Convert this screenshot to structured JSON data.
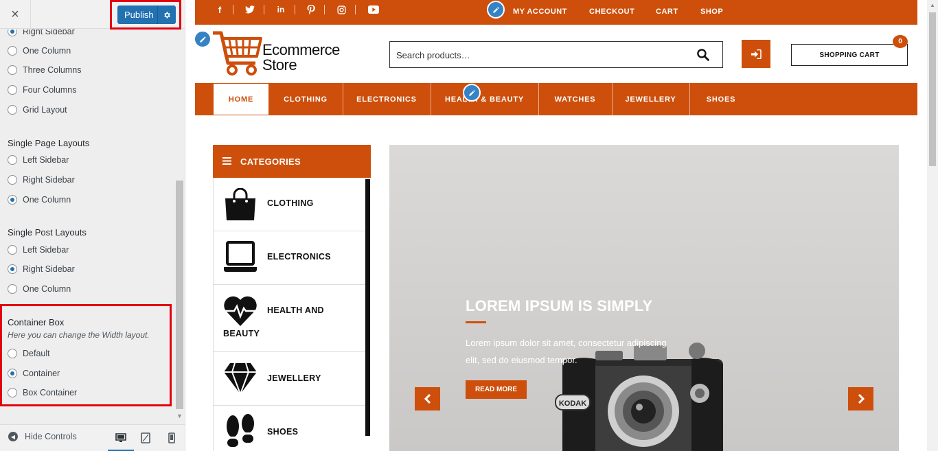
{
  "customizer": {
    "close_symbol": "×",
    "publish_label": "Publish",
    "archive_options": [
      {
        "label": "Right Sidebar",
        "checked": true
      },
      {
        "label": "One Column",
        "checked": false
      },
      {
        "label": "Three Columns",
        "checked": false
      },
      {
        "label": "Four Columns",
        "checked": false
      },
      {
        "label": "Grid Layout",
        "checked": false
      }
    ],
    "single_page": {
      "title": "Single Page Layouts",
      "options": [
        {
          "label": "Left Sidebar",
          "checked": false
        },
        {
          "label": "Right Sidebar",
          "checked": false
        },
        {
          "label": "One Column",
          "checked": true
        }
      ]
    },
    "single_post": {
      "title": "Single Post Layouts",
      "options": [
        {
          "label": "Left Sidebar",
          "checked": false
        },
        {
          "label": "Right Sidebar",
          "checked": true
        },
        {
          "label": "One Column",
          "checked": false
        }
      ]
    },
    "container_box": {
      "title": "Container Box",
      "description": "Here you can change the Width layout.",
      "options": [
        {
          "label": "Default",
          "checked": false
        },
        {
          "label": "Container",
          "checked": true
        },
        {
          "label": "Box Container",
          "checked": false
        }
      ]
    },
    "footer": {
      "hide_controls_label": "Hide Controls",
      "active_device": "desktop"
    }
  },
  "preview": {
    "topbar": {
      "social_icons": [
        "facebook-icon",
        "twitter-icon",
        "linkedin-icon",
        "pinterest-icon",
        "instagram-icon",
        "youtube-icon"
      ],
      "links": [
        "MY ACCOUNT",
        "CHECKOUT",
        "CART",
        "SHOP"
      ]
    },
    "logo": {
      "line1": "Ecommerce",
      "line2": "Store"
    },
    "search": {
      "placeholder": "Search products…"
    },
    "cart": {
      "label": "SHOPPING CART",
      "count": "0"
    },
    "nav": {
      "items": [
        "HOME",
        "CLOTHING",
        "ELECTRONICS",
        "HEALTH & BEAUTY",
        "WATCHES",
        "JEWELLERY",
        "SHOES"
      ],
      "active": "HOME"
    },
    "categories": {
      "title": "CATEGORIES",
      "items": [
        {
          "label": "CLOTHING",
          "icon": "shopping-bag-icon"
        },
        {
          "label": "ELECTRONICS",
          "icon": "laptop-icon"
        },
        {
          "label": "HEALTH AND",
          "label2": "BEAUTY",
          "icon": "heartbeat-icon"
        },
        {
          "label": "JEWELLERY",
          "icon": "diamond-icon"
        },
        {
          "label": "SHOES",
          "icon": "shoe-prints-icon"
        }
      ]
    },
    "hero": {
      "title": "LOREM IPSUM IS SIMPLY",
      "text": "Lorem ipsum dolor sit amet, consectetur adipiscing elit, sed do eiusmod tempor.",
      "button": "READ MORE",
      "camera_brand": "KODAK"
    },
    "colors": {
      "accent": "#cd4f0b",
      "customizer_blue": "#2271b1",
      "highlight_red": "#e3000f"
    }
  }
}
